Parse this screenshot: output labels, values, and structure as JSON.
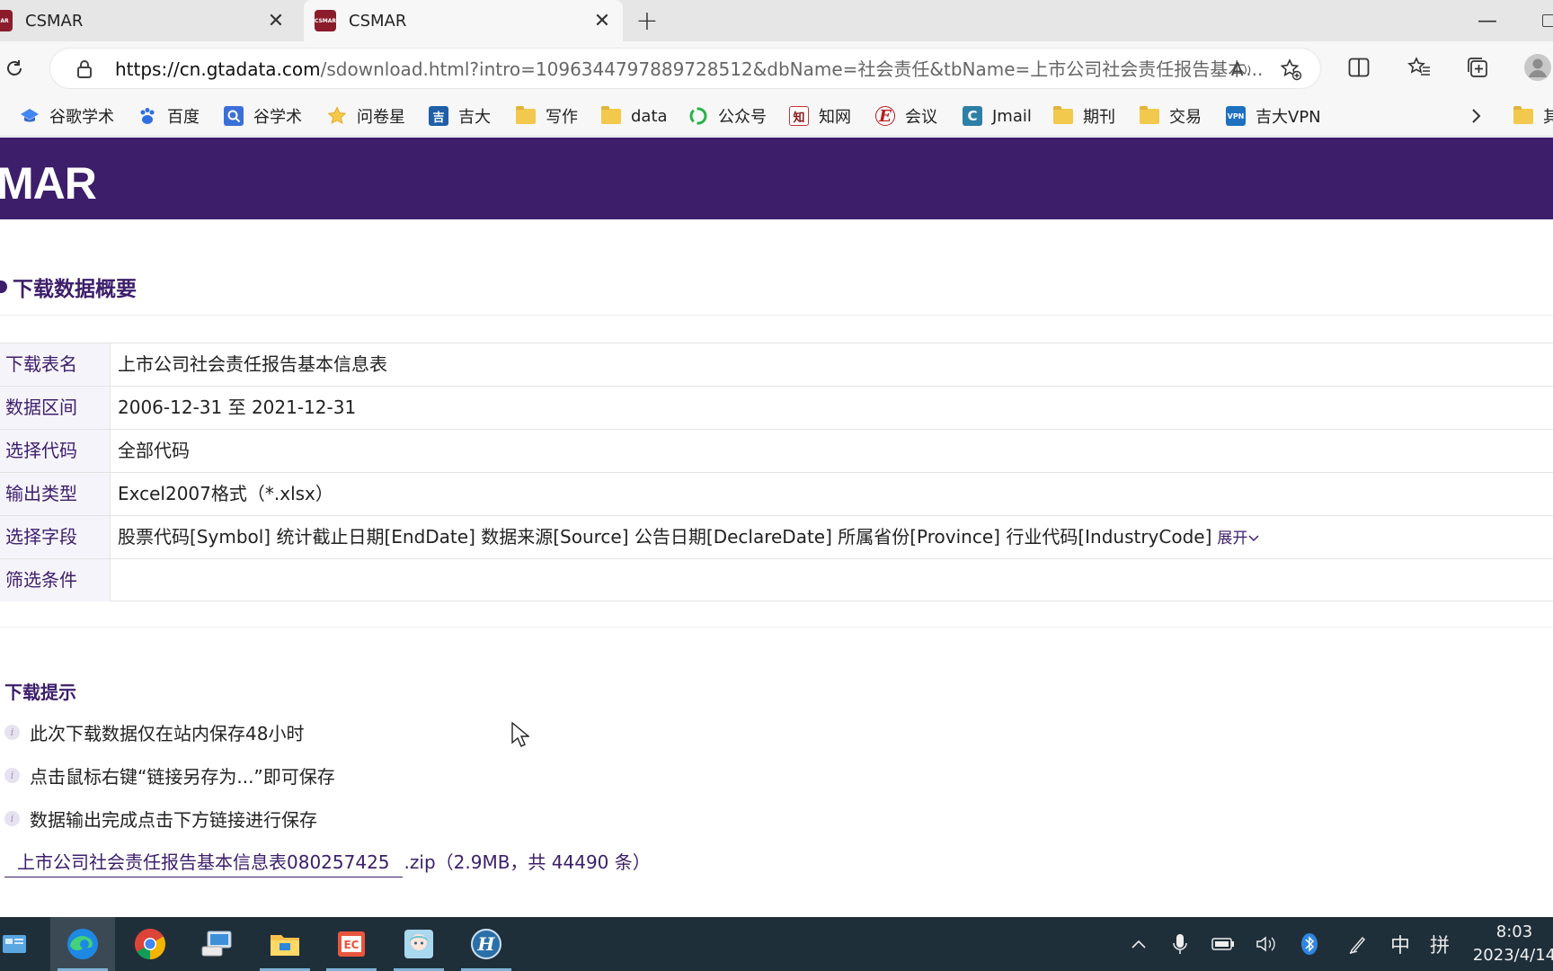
{
  "browser": {
    "tabs": [
      {
        "title": "CSMAR",
        "favicon_text": "MAR"
      },
      {
        "title": "CSMAR",
        "favicon_text": "CSMAR"
      }
    ],
    "url_host": "https://cn.gtadata.com",
    "url_rest": "/sdownload.html?intro=1096344797889728512&dbName=社会责任&tbName=上市公司社会责任报告基本...",
    "bookmarks": [
      {
        "label": "谷歌学术",
        "icon": "graduation-cap-icon"
      },
      {
        "label": "百度",
        "icon": "baidu-paw-icon"
      },
      {
        "label": "谷学术",
        "icon": "magnifier-icon"
      },
      {
        "label": "问卷星",
        "icon": "star-icon"
      },
      {
        "label": "吉大",
        "icon": "university-logo-icon"
      },
      {
        "label": "写作",
        "icon": "folder-icon"
      },
      {
        "label": "data",
        "icon": "folder-icon"
      },
      {
        "label": "公众号",
        "icon": "wechat-icon"
      },
      {
        "label": "知网",
        "icon": "cnki-icon"
      },
      {
        "label": "会议",
        "icon": "e-icon"
      },
      {
        "label": "Jmail",
        "icon": "c-icon"
      },
      {
        "label": "期刊",
        "icon": "folder-icon"
      },
      {
        "label": "交易",
        "icon": "folder-icon"
      },
      {
        "label": "吉大VPN",
        "icon": "vpn-icon"
      },
      {
        "label": "其",
        "icon": "folder-icon"
      }
    ]
  },
  "site": {
    "logo_text": "MAR",
    "brand_color": "#3c1e6b"
  },
  "overview": {
    "title": "下载数据概要",
    "rows": [
      {
        "label": "下载表名",
        "value": "上市公司社会责任报告基本信息表"
      },
      {
        "label": "数据区间",
        "value": "2006-12-31 至 2021-12-31"
      },
      {
        "label": "选择代码",
        "value": "全部代码"
      },
      {
        "label": "输出类型",
        "value": "Excel2007格式（*.xlsx）"
      },
      {
        "label": "选择字段",
        "value": "股票代码[Symbol] 统计截止日期[EndDate] 数据来源[Source] 公告日期[DeclareDate] 所属省份[Province] 行业代码[IndustryCode]"
      },
      {
        "label": "筛选条件",
        "value": ""
      }
    ],
    "expand_label": "展开"
  },
  "tips": {
    "title": "下载提示",
    "items": [
      "此次下载数据仅在站内保存48小时",
      "点击鼠标右键“链接另存为...”即可保存",
      "数据输出完成点击下方链接进行保存"
    ],
    "file_link": "上市公司社会责任报告基本信息表080257425",
    "file_meta": ".zip（2.9MB，共 44490 条）"
  },
  "taskbar": {
    "apps": [
      "start",
      "edge",
      "chrome",
      "remote-desktop",
      "file-explorer",
      "presentation-app",
      "anime-app",
      "h-app"
    ],
    "ime_lang": "中",
    "ime_mode": "拼",
    "time": "8:03",
    "date": "2023/4/14"
  }
}
